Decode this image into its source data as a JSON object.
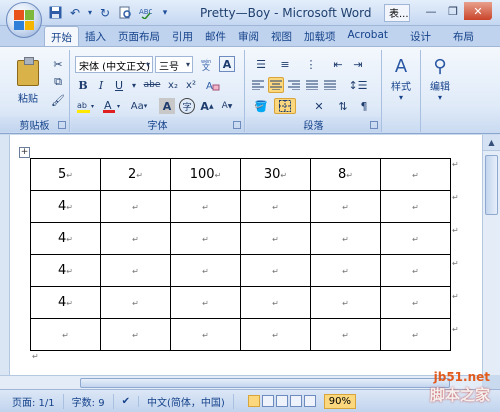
{
  "window": {
    "title": "Pretty—Boy - Microsoft Word",
    "other_tab": "表..."
  },
  "qat": {
    "save_icon": "save-icon",
    "undo_icon": "undo-icon",
    "redo_icon": "redo-icon",
    "print_icon": "print-preview-icon",
    "customize": "▾"
  },
  "ribbon_tabs": [
    {
      "label": "开始",
      "active": true
    },
    {
      "label": "插入"
    },
    {
      "label": "页面布局"
    },
    {
      "label": "引用"
    },
    {
      "label": "邮件"
    },
    {
      "label": "审阅"
    },
    {
      "label": "视图"
    },
    {
      "label": "加载项"
    },
    {
      "label": "Acrobat"
    },
    {
      "label": "设计"
    },
    {
      "label": "布局"
    }
  ],
  "ribbon": {
    "clipboard": {
      "paste_label": "粘贴",
      "group_label": "剪贴板"
    },
    "font": {
      "font_name": "宋体 (中文正文)",
      "font_size": "三号",
      "group_label": "字体",
      "bold": "B",
      "italic": "I",
      "underline": "U",
      "strike": "abe",
      "subscript": "x₂",
      "superscript": "x²",
      "aa_label": "Aa",
      "font_color_label": "A",
      "grow": "A",
      "shrink": "A"
    },
    "paragraph": {
      "group_label": "段落"
    },
    "styles": {
      "label": "样式"
    },
    "editing": {
      "label": "编辑"
    }
  },
  "table": {
    "rows": [
      [
        "5",
        "2",
        "100",
        "30",
        "8",
        ""
      ],
      [
        "4",
        "",
        "",
        "",
        "",
        ""
      ],
      [
        "4",
        "",
        "",
        "",
        "",
        ""
      ],
      [
        "4",
        "",
        "",
        "",
        "",
        ""
      ],
      [
        "4",
        "",
        "",
        "",
        "",
        ""
      ],
      [
        "",
        "",
        "",
        "",
        "",
        ""
      ]
    ]
  },
  "status": {
    "page": "页面: 1/1",
    "words": "字数: 9",
    "language": "中文(简体，中国)",
    "zoom": "90%"
  },
  "watermark": {
    "line1": "jb51.net",
    "line2": "脚本之家"
  }
}
